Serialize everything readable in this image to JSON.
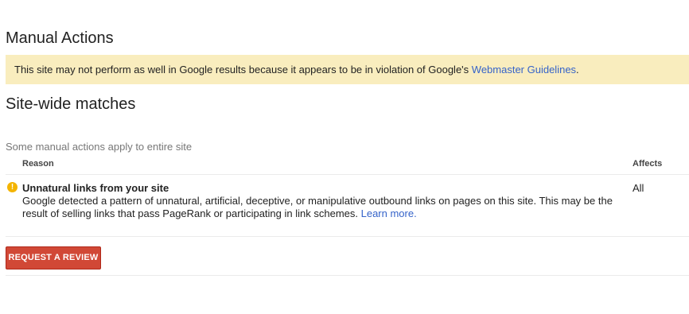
{
  "page": {
    "title": "Manual Actions"
  },
  "banner": {
    "text": "This site may not perform as well in Google results because it appears to be in violation of Google's ",
    "link_text": "Webmaster Guidelines",
    "suffix": "."
  },
  "section": {
    "title": "Site-wide matches",
    "subtitle": "Some manual actions apply to entire site"
  },
  "table": {
    "columns": {
      "reason": "Reason",
      "affects": "Affects"
    },
    "rows": [
      {
        "icon": "warning-icon",
        "title": "Unnatural links from your site",
        "description": "Google detected a pattern of unnatural, artificial, deceptive, or manipulative outbound links on pages on this site. This may be the result of selling links that pass PageRank or participating in link schemes. ",
        "link_text": "Learn more.",
        "affects": "All"
      }
    ]
  },
  "actions": {
    "request_review_label": "REQUEST A REVIEW"
  },
  "colors": {
    "banner_bg": "#f9edbe",
    "link": "#3563c9",
    "button_bg": "#d14836",
    "warning": "#f4b400"
  }
}
